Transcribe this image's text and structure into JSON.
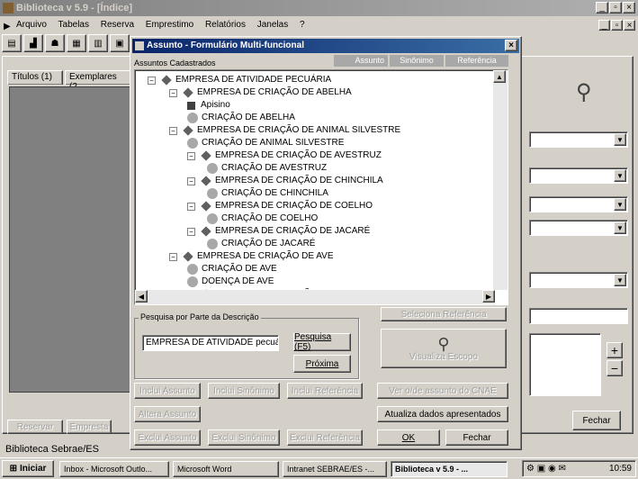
{
  "main_window": {
    "title": "Biblioteca v 5.9 - [Índice]",
    "menu": [
      "Arquivo",
      "Tabelas",
      "Reserva",
      "Emprestimo",
      "Relatórios",
      "Janelas",
      "?"
    ],
    "tabs": [
      "Títulos (1)",
      "Exemplares (2"
    ],
    "bottom_buttons": [
      "Reservar",
      "Empresta"
    ],
    "fechar_label": "Fechar",
    "status_text": "Biblioteca Sebrae/ES"
  },
  "dialog": {
    "title": "Assunto - Formulário Multi-funcional",
    "close_label": "×",
    "section_label": "Assuntos Cadastrados",
    "header_tabs": [
      "Assunto",
      "Sinônimo",
      "Referência"
    ],
    "tree": [
      {
        "level": 0,
        "kind": "root",
        "label": "EMPRESA DE ATIVIDADE PECUÁRIA"
      },
      {
        "level": 1,
        "kind": "node",
        "label": "EMPRESA DE CRIAÇÃO DE ABELHA"
      },
      {
        "level": 2,
        "kind": "square",
        "label": "Apisino"
      },
      {
        "level": 2,
        "kind": "leaf",
        "label": "CRIAÇÃO DE ABELHA"
      },
      {
        "level": 1,
        "kind": "node",
        "label": "EMPRESA DE CRIAÇÃO DE ANIMAL SILVESTRE"
      },
      {
        "level": 2,
        "kind": "leaf",
        "label": "CRIAÇÃO DE ANIMAL SILVESTRE"
      },
      {
        "level": 2,
        "kind": "node",
        "label": "EMPRESA DE CRIAÇÃO DE AVESTRUZ"
      },
      {
        "level": 3,
        "kind": "leaf",
        "label": "CRIAÇÃO DE AVESTRUZ"
      },
      {
        "level": 2,
        "kind": "node",
        "label": "EMPRESA DE CRIAÇÃO DE CHINCHILA"
      },
      {
        "level": 3,
        "kind": "leaf",
        "label": "CRIAÇÃO DE CHINCHILA"
      },
      {
        "level": 2,
        "kind": "node",
        "label": "EMPRESA DE CRIAÇÃO DE COELHO"
      },
      {
        "level": 3,
        "kind": "leaf",
        "label": "CRIAÇÃO DE COELHO"
      },
      {
        "level": 2,
        "kind": "node",
        "label": "EMPRESA DE CRIAÇÃO DE JACARÉ"
      },
      {
        "level": 3,
        "kind": "leaf",
        "label": "CRIAÇÃO DE JACARÉ"
      },
      {
        "level": 1,
        "kind": "node",
        "label": "EMPRESA DE CRIAÇÃO DE AVE"
      },
      {
        "level": 2,
        "kind": "leaf",
        "label": "CRIAÇÃO DE AVE"
      },
      {
        "level": 2,
        "kind": "leaf",
        "label": "DOENÇA DE AVE"
      },
      {
        "level": 2,
        "kind": "node",
        "label": "EMPRESA DE CRIAÇÃO DE FRANGO"
      }
    ],
    "search_group_label": "Pesquisa por Parte da Descrição",
    "search_value": "EMPRESA DE ATIVIDADE pecuá",
    "pesquisa_label": "Pesquisa (F5)",
    "proxima_label": "Próxima",
    "seleciona_label": "Seleciona Referência",
    "visualiza_label": "Visualiza Escopo",
    "buttons_row1": [
      "Inclui Assunto",
      "Inclui Sinônimo",
      "Inclui Referência",
      "Ver o/de assunto do CNAE"
    ],
    "buttons_row2_left": "Altera Assunto",
    "atualiza_label": "Atualiza dados apresentados",
    "buttons_row3": [
      "Exclui Assunto",
      "Exclui Sinônimo",
      "Exclui Referência"
    ],
    "ok_label": "OK",
    "fechar_label": "Fechar"
  },
  "taskbar": {
    "start_label": "Iniciar",
    "items": [
      "Inbox - Microsoft Outlo...",
      "Microsoft Word",
      "Intranet SEBRAE/ES -...",
      "Biblioteca v 5.9 - ..."
    ],
    "clock": "10:59"
  }
}
